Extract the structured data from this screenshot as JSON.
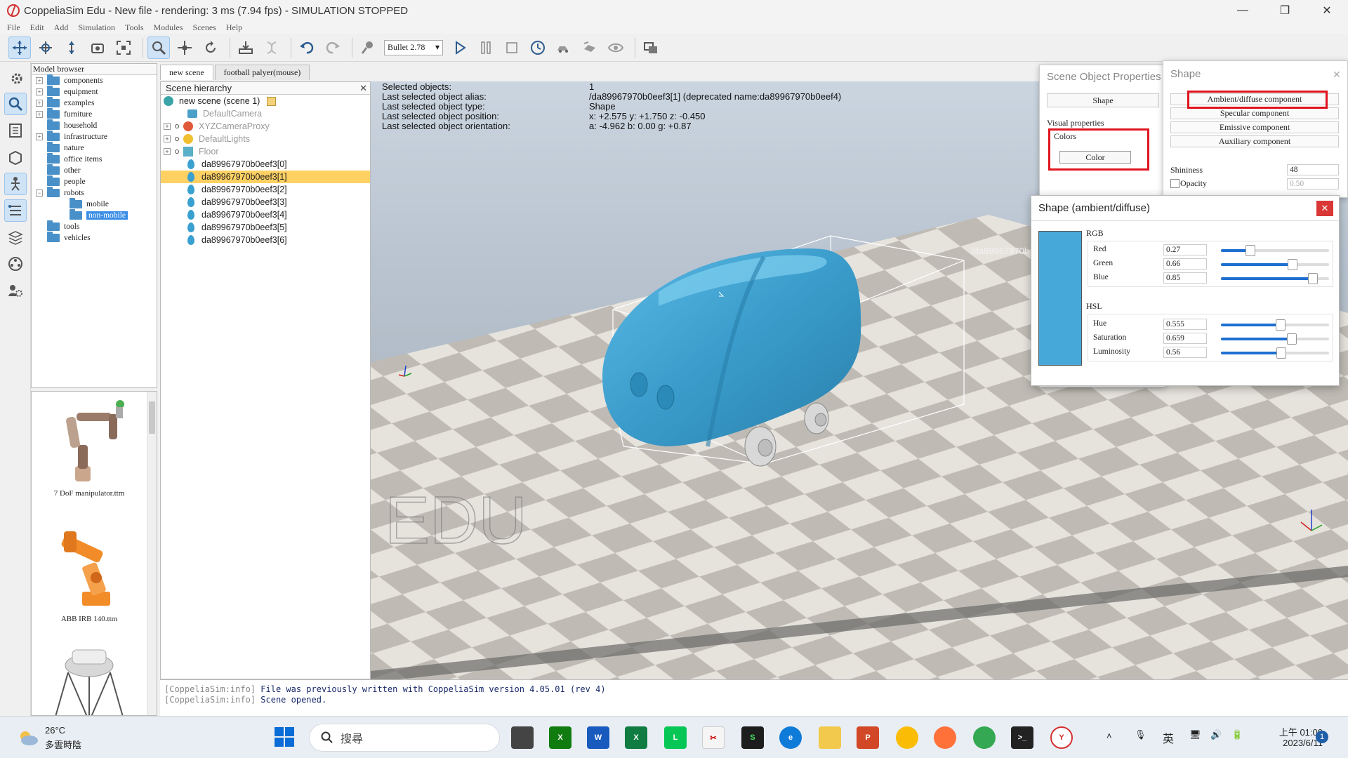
{
  "window": {
    "title": "CoppeliaSim Edu - New file - rendering: 3 ms (7.94 fps) - SIMULATION STOPPED",
    "minimize": "—",
    "maximize": "❐",
    "close": "✕"
  },
  "menu": [
    "File",
    "Edit",
    "Add",
    "Simulation",
    "Tools",
    "Modules",
    "Scenes",
    "Help"
  ],
  "toolbar": {
    "engine": "Bullet 2.78"
  },
  "model_browser": {
    "header": "Model browser",
    "items": [
      {
        "label": "components",
        "expander": "+"
      },
      {
        "label": "equipment",
        "expander": "+"
      },
      {
        "label": "examples",
        "expander": "+"
      },
      {
        "label": "furniture",
        "expander": "+"
      },
      {
        "label": "household",
        "expander": ""
      },
      {
        "label": "infrastructure",
        "expander": "+"
      },
      {
        "label": "nature",
        "expander": ""
      },
      {
        "label": "office items",
        "expander": ""
      },
      {
        "label": "other",
        "expander": ""
      },
      {
        "label": "people",
        "expander": ""
      },
      {
        "label": "robots",
        "expander": "−"
      },
      {
        "label": "mobile",
        "expander": ""
      },
      {
        "label": "non-mobile",
        "expander": ""
      },
      {
        "label": "tools",
        "expander": ""
      },
      {
        "label": "vehicles",
        "expander": ""
      }
    ]
  },
  "thumbnails": [
    {
      "label": "7 DoF manipulator.ttm"
    },
    {
      "label": "ABB IRB 140.ttm"
    },
    {
      "label": ""
    }
  ],
  "tabs": [
    "new scene",
    "football palyer(mouse)"
  ],
  "hierarchy": {
    "header": "Scene hierarchy",
    "close": "✕",
    "rows": [
      {
        "label": "new scene (scene 1)"
      },
      {
        "label": "DefaultCamera"
      },
      {
        "label": "XYZCameraProxy"
      },
      {
        "label": "DefaultLights"
      },
      {
        "label": "Floor"
      },
      {
        "label": "da89967970b0eef3[0]"
      },
      {
        "label": "da89967970b0eef3[1]"
      },
      {
        "label": "da89967970b0eef3[2]"
      },
      {
        "label": "da89967970b0eef3[3]"
      },
      {
        "label": "da89967970b0eef3[4]"
      },
      {
        "label": "da89967970b0eef3[5]"
      },
      {
        "label": "da89967970b0eef3[6]"
      }
    ]
  },
  "info": {
    "labels": [
      "Selected objects:",
      "Last selected object alias:",
      "Last selected object type:",
      "Last selected object position:",
      "Last selected object orientation:"
    ],
    "values": [
      "1",
      "/da89967970b0eef3[1]   (deprecated name:da89967970b0eef4)",
      "Shape",
      "x: +2.575    y: +1.750    z: -0.450",
      "a: -4.962    b: 0.00    g: +0.87"
    ],
    "object_tag": "/da89967970b",
    "watermark": "EDU"
  },
  "console": [
    {
      "src": "[CoppeliaSim:info]",
      "msg": "File was previously written with CoppeliaSim version 4.05.01 (rev 4)"
    },
    {
      "src": "[CoppeliaSim:info]",
      "msg": "Scene opened."
    }
  ],
  "sop": {
    "title": "Scene Object Properties",
    "shape_button": "Shape",
    "visual_properties": "Visual properties",
    "colors": "Colors",
    "color_button": "Color"
  },
  "shape": {
    "title": "Shape",
    "close": "✕",
    "ambient": "Ambient/diffuse component",
    "specular": "Specular component",
    "emissive": "Emissive component",
    "auxiliary": "Auxiliary component",
    "shininess_label": "Shininess",
    "shininess_value": "48",
    "opacity_label": "Opacity",
    "opacity_value": "0.50"
  },
  "color_dialog": {
    "title": "Shape (ambient/diffuse)",
    "close": "✕",
    "rgb_label": "RGB",
    "hsl_label": "HSL",
    "red_label": "Red",
    "red_value": "0.27",
    "green_label": "Green",
    "green_value": "0.66",
    "blue_label": "Blue",
    "blue_value": "0.85",
    "hue_label": "Hue",
    "hue_value": "0.555",
    "sat_label": "Saturation",
    "sat_value": "0.659",
    "lum_label": "Luminosity",
    "lum_value": "0.56",
    "swatch_color": "#46a8d9"
  },
  "taskbar": {
    "temp": "26°C",
    "weather": "多雲時陰",
    "search": "搜尋",
    "ime": "英",
    "time": "上午 01:00",
    "date": "2023/6/11",
    "badge": "1"
  },
  "colors": {
    "accent": "#3a8ee6",
    "selection": "#ffd163",
    "highlight_box": "#e0141e",
    "car_body": "#3a9ccb"
  }
}
